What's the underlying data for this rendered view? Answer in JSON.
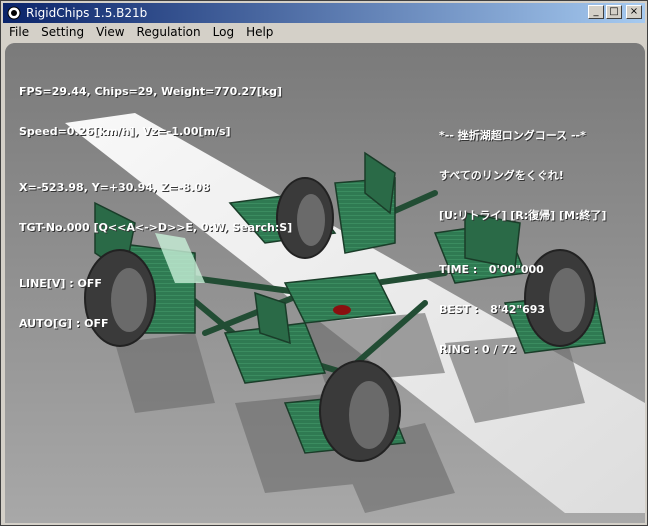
{
  "window": {
    "title": "RigidChips 1.5.B21b",
    "buttons": {
      "minimize": "_",
      "maximize": "□",
      "close": "×"
    }
  },
  "menu": [
    "File",
    "Setting",
    "View",
    "Regulation",
    "Log",
    "Help"
  ],
  "hud_left": {
    "stats1": "FPS=29.44, Chips=29, Weight=770.27[kg]",
    "stats2": "Speed=0.26[km/h], Vz=-1.00[m/s]",
    "coords": "X=-523.98, Y=+30.94, Z=-8.08",
    "target": "TGT-No.000 [Q<<A<->D>>E, 0:W, Search:S]",
    "line_toggle": "LINE[V] : OFF",
    "auto_toggle": "AUTO[G] : OFF"
  },
  "hud_right": {
    "course_title": "*-- 挫折湖超ロングコース --*",
    "instruction": "すべてのリングをくぐれ!",
    "keys": "[U:リトライ] [R:復帰] [M:終了]",
    "time_label": "TIME :",
    "time_value": "0'00\"000",
    "best_label": "BEST :",
    "best_value": "8'42\"693",
    "ring_label": "RING : 0 / 72"
  }
}
